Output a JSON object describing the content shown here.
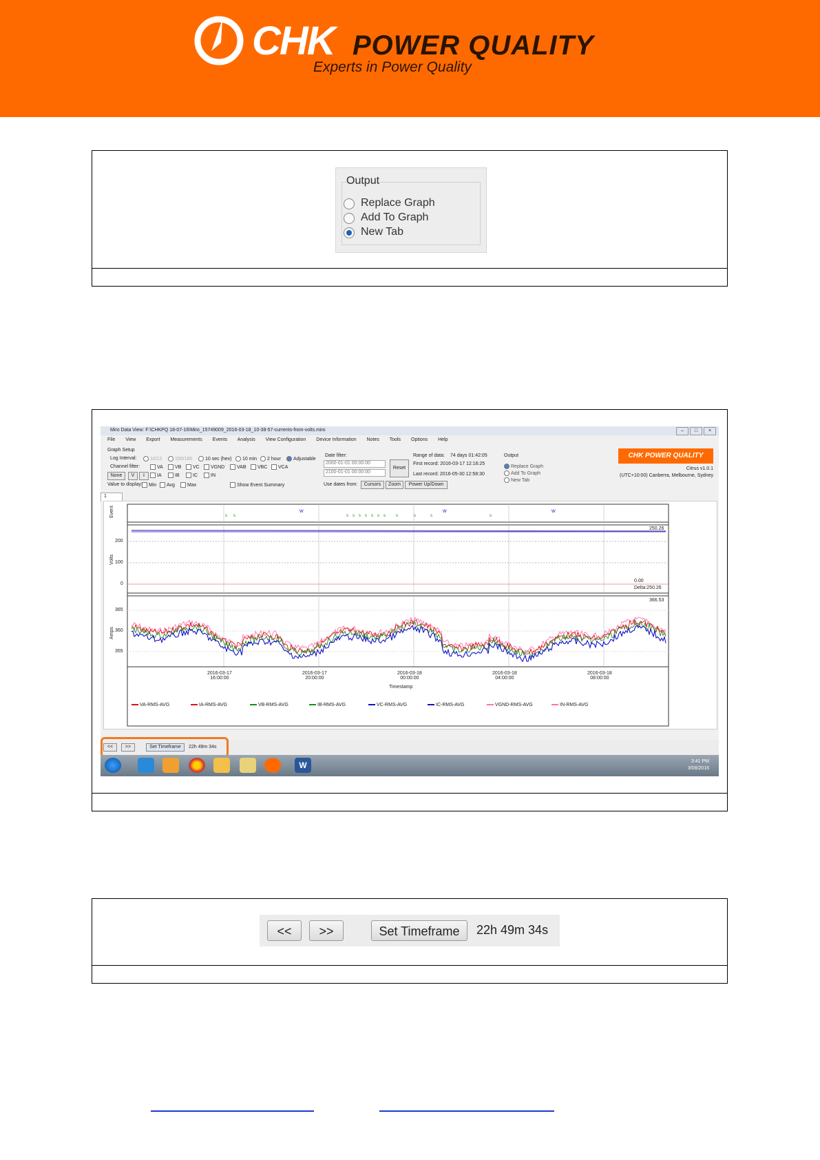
{
  "header": {
    "brand": "CHK",
    "brand_suffix": "POWER QUALITY",
    "tagline": "Experts in Power Quality",
    "brand_color": "#ff6a00"
  },
  "figure1": {
    "group_title": "Output",
    "options": [
      {
        "label": "Replace Graph",
        "selected": false
      },
      {
        "label": "Add To Graph",
        "selected": false
      },
      {
        "label": "New Tab",
        "selected": true
      }
    ]
  },
  "figure2": {
    "window_title": "Miro Data View: F:\\CHKPQ 18-07-16\\Miro_15749009_2016-03-18_10-38-57-currents-from-volts.miro",
    "menu": [
      "File",
      "View",
      "Export",
      "Measurements",
      "Events",
      "Analysis",
      "View Configuration",
      "Device Information",
      "Notes",
      "Tools",
      "Options",
      "Help"
    ],
    "graph_setup_label": "Graph Setup",
    "log_interval_label": "Log Interval:",
    "log_intervals": [
      "10/12",
      "150/180",
      "10 sec (hex)",
      "10 min",
      "2 hour",
      "Adjustable"
    ],
    "channel_filter_label": "Channel filter:",
    "channel_row1": [
      "VA",
      "VB",
      "VC",
      "VGND",
      "VAB",
      "VBC",
      "VCA"
    ],
    "channel_row2": [
      "IA",
      "IB",
      "IC",
      "IN"
    ],
    "none_button": "None",
    "v_button": "V",
    "i_button": "I",
    "value_to_display_label": "Value to display:",
    "value_options": [
      "Min",
      "Avg",
      "Max"
    ],
    "show_event_summary": "Show Event Summary",
    "date_filter_label": "Date filter:",
    "date_from": "2000-01-01 00:00:00",
    "date_to": "2100-01-01 00:00:00",
    "reset_button": "Reset",
    "use_dates_label": "Use dates from:",
    "cursors_button": "Cursors",
    "zoom_button": "Zoom",
    "power_button": "Power Up/Down",
    "range_label": "Range of data:",
    "range_value": "74 days 01:42:05",
    "first_record": "First record: 2016-03-17 12:16:25",
    "last_record": "Last record: 2016-05-30 12:58:30",
    "output_label": "Output",
    "output_options": [
      "Replace Graph",
      "Add To Graph",
      "New Tab"
    ],
    "version": "Citrus v1.0.1",
    "timezone": "(UTC+10:00) Canberra, Melbourne, Sydney",
    "tab_label": "1",
    "event_axis_label": "Event",
    "volts_axis_label": "Volts",
    "amps_axis_label": "Amps",
    "volts_ticks": [
      "200",
      "100",
      "0"
    ],
    "amps_ticks": [
      "365",
      "360",
      "355"
    ],
    "readout_top": "250.26",
    "readout_zero": "0.00",
    "readout_delta": "Delta:250.26",
    "readout_amps": "366.53",
    "x_ticks": [
      [
        "2016-03-17",
        "16:00:00"
      ],
      [
        "2016-03-17",
        "20:00:00"
      ],
      [
        "2016-03-18",
        "00:00:00"
      ],
      [
        "2016-03-18",
        "04:00:00"
      ],
      [
        "2016-03-18",
        "08:00:00"
      ]
    ],
    "x_axis_label": "Timestamp",
    "legend": [
      {
        "name": "VA-RMS-AVG",
        "color": "#e01010"
      },
      {
        "name": "IA-RMS-AVG",
        "color": "#e01010"
      },
      {
        "name": "VB-RMS-AVG",
        "color": "#1a8a1a"
      },
      {
        "name": "IB-RMS-AVG",
        "color": "#1a8a1a"
      },
      {
        "name": "VC-RMS-AVG",
        "color": "#1010c8"
      },
      {
        "name": "IC-RMS-AVG",
        "color": "#1010c8"
      },
      {
        "name": "VGND-RMS-AVG",
        "color": "#ff70b0"
      },
      {
        "name": "IN-RMS-AVG",
        "color": "#ff70b0"
      }
    ],
    "nav_prev": "<<",
    "nav_next": ">>",
    "set_timeframe": "Set Timeframe",
    "duration": "22h 49m 34s",
    "clock_time": "3:41 PM",
    "clock_date": "3/08/2016"
  },
  "figure3": {
    "prev_label": "<<",
    "next_label": ">>",
    "set_timeframe_label": "Set Timeframe",
    "duration": "22h 49m 34s"
  }
}
